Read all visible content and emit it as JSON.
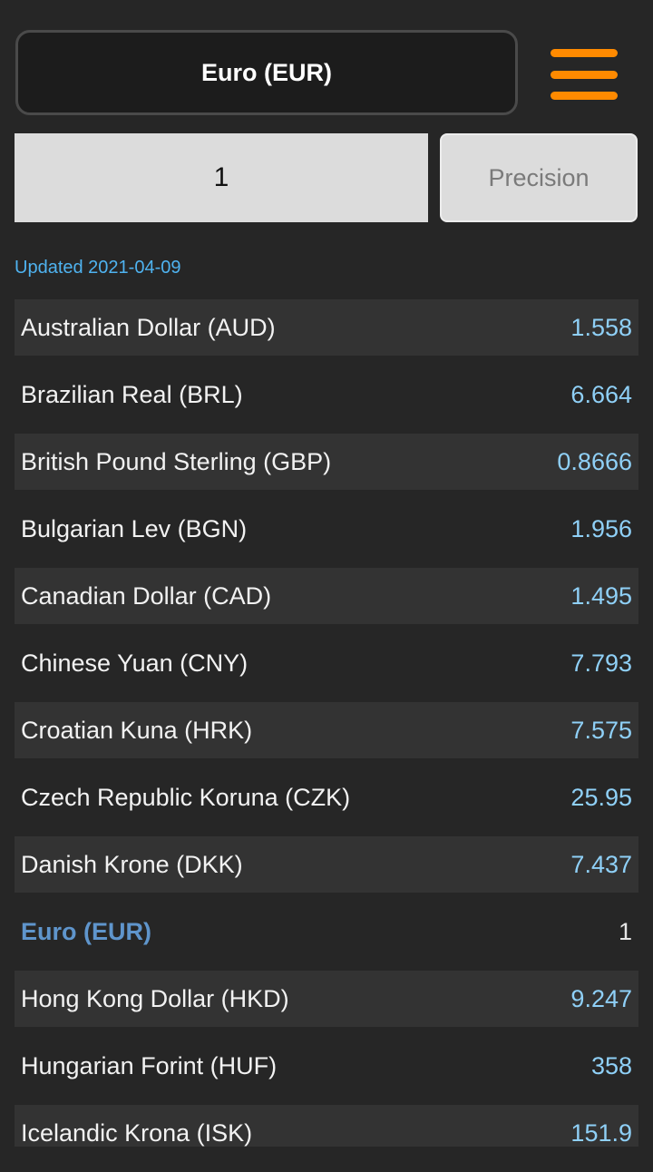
{
  "base_currency": "Euro (EUR)",
  "amount": "1",
  "precision_label": "Precision",
  "updated_text": "Updated 2021-04-09",
  "accent_color": "#ff8a00",
  "rates": [
    {
      "name": "Australian Dollar (AUD)",
      "value": "1.558"
    },
    {
      "name": "Brazilian Real (BRL)",
      "value": "6.664"
    },
    {
      "name": "British Pound Sterling (GBP)",
      "value": "0.8666"
    },
    {
      "name": "Bulgarian Lev (BGN)",
      "value": "1.956"
    },
    {
      "name": "Canadian Dollar (CAD)",
      "value": "1.495"
    },
    {
      "name": "Chinese Yuan (CNY)",
      "value": "7.793"
    },
    {
      "name": "Croatian Kuna (HRK)",
      "value": "7.575"
    },
    {
      "name": "Czech Republic Koruna (CZK)",
      "value": "25.95"
    },
    {
      "name": "Danish Krone (DKK)",
      "value": "7.437"
    },
    {
      "name": "Euro (EUR)",
      "value": "1"
    },
    {
      "name": "Hong Kong Dollar (HKD)",
      "value": "9.247"
    },
    {
      "name": "Hungarian Forint (HUF)",
      "value": "358"
    },
    {
      "name": "Icelandic Krona (ISK)",
      "value": "151.9"
    }
  ]
}
